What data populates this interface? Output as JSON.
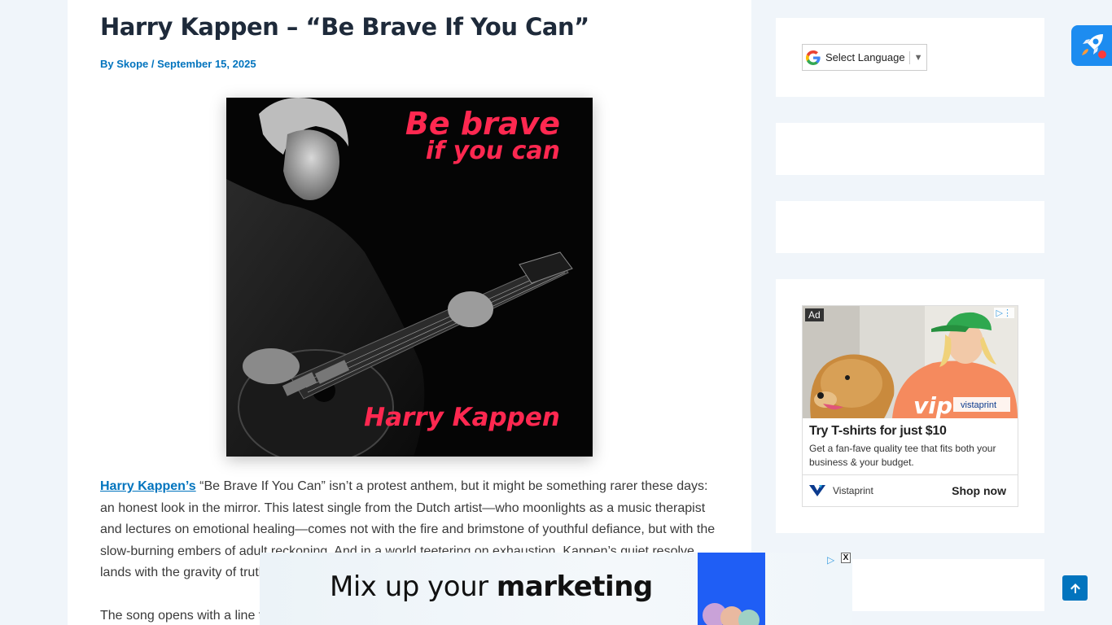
{
  "article": {
    "title": "Harry Kappen – “Be Brave If You Can”",
    "meta": {
      "by": "By",
      "author": "Skope",
      "separator": "/",
      "date": "September 15, 2025"
    },
    "cover": {
      "line1": "Be brave",
      "line2": "if you can",
      "artist": "Harry Kappen"
    },
    "paragraph1": {
      "link": "Harry Kappen’s",
      "text": " “Be Brave If You Can” isn’t a protest anthem, but it might be something rarer these days: an honest look in the mirror. This latest single from the Dutch artist—who moonlights as a music therapist and lectures on emotional healing—comes not with the fire and brimstone of youthful defiance, but with the slow-burning embers of adult reckoning. And in a world teetering on exhaustion, Kappen’s quiet resolve lands with the gravity of truth."
    },
    "paragraph2": "The song opens with a line t"
  },
  "sidebar": {
    "language": {
      "label": "Select Language",
      "arrow": "▼"
    },
    "ad": {
      "tag": "Ad",
      "adchoices": "▷⋮",
      "title": "Try T-shirts for just $10",
      "description": "Get a fan-fave quality tee that fits both your business & your budget.",
      "brand": "Vistaprint",
      "cta": "Shop now"
    }
  },
  "bottom_ad": {
    "headline_regular": "Mix up your ",
    "headline_bold": "marketing",
    "adchoice": "▷",
    "close": "X"
  },
  "icons": {
    "rocket": "rocket-icon",
    "scroll_top": "arrow-up-icon",
    "google": "google-icon"
  },
  "colors": {
    "link": "#0274be",
    "cover_text": "#ff2850",
    "background": "#f0f5fa"
  }
}
